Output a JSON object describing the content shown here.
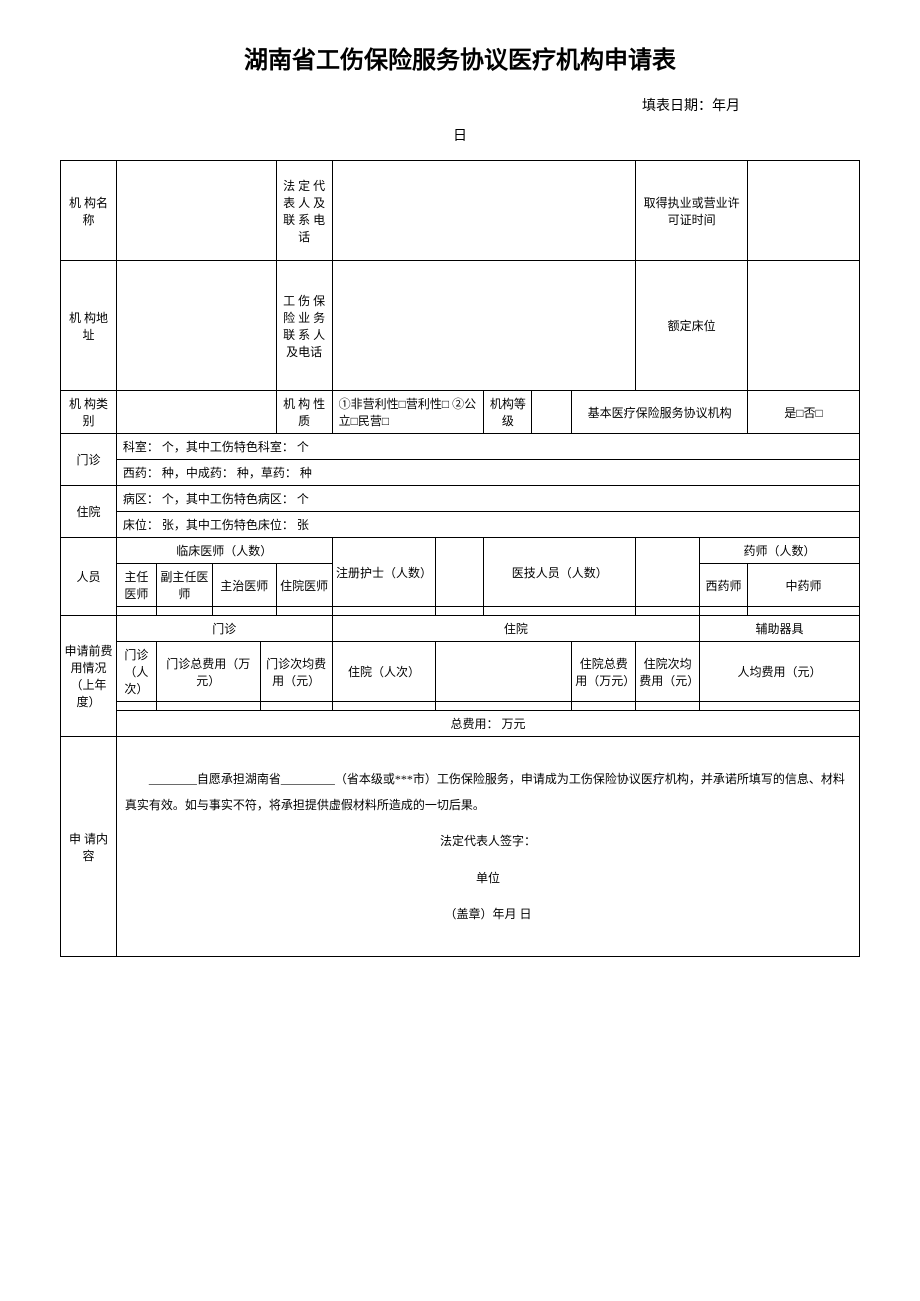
{
  "title": "湖南省工伤保险服务协议医疗机构申请表",
  "dateLabel": "填表日期：年月",
  "dateDay": "日",
  "row1": {
    "orgName": "机 构名称",
    "legalRep": "法 定 代表 人 及联 系 电话",
    "licenseTime": "取得执业或营业许可证时间"
  },
  "row2": {
    "orgAddr": "机 构地址",
    "insContact": "工 伤 保险 业 务联 系 人及电话",
    "beds": "额定床位"
  },
  "row3": {
    "orgType": "机 构类别",
    "orgNature": "机 构 性质",
    "natureOptions": "①非营利性□营利性□ ②公立□民营□",
    "orgLevel": "机构等级",
    "basicIns": "基本医疗保险服务协议机构",
    "yesNo": "是□否□"
  },
  "outpatient": {
    "label": "门诊",
    "dept": "科室：        个，其中工伤特色科室：        个",
    "med": "西药：        种，中成药：        种，草药：        种"
  },
  "inpatient": {
    "label": "住院",
    "ward": "病区：        个，其中工伤特色病区：        个",
    "bed": "床位：        张，其中工伤特色床位：        张"
  },
  "staff": {
    "label": "人员",
    "clinician": "临床医师（人数）",
    "chief": "主任医师",
    "deputy": "副主任医师",
    "attending": "主治医师",
    "resident": "住院医师",
    "nurse": "注册护士（人数）",
    "tech": "医技人员（人数）",
    "pharmacist": "药师（人数）",
    "western": "西药师",
    "chinese": "中药师"
  },
  "cost": {
    "label": "申请前费用情况（上年度）",
    "outpatient": "门诊",
    "outVisits": "门诊（人次）",
    "outTotal": "门诊总费用（万元）",
    "outAvg": "门诊次均费用（元）",
    "inpatient": "住院",
    "inVisits": "住院（人次）",
    "inTotal": "住院总费用（万元）",
    "inAvg": "住院次均费用（元）",
    "aux": "辅助器具",
    "auxAvg": "人均费用（元）",
    "total": "总费用：                万元"
  },
  "application": {
    "label": "申 请内容",
    "text1": "________自愿承担湖南省_________（省本级或***市）工伤保险服务，申请成为工伤保险协议医疗机构，并承诺所填写的信息、材料真实有效。如与事实不符，将承担提供虚假材料所造成的一切后果。",
    "sig": "法定代表人签字：",
    "unit": "单位",
    "seal": "（盖章）年月  日"
  }
}
